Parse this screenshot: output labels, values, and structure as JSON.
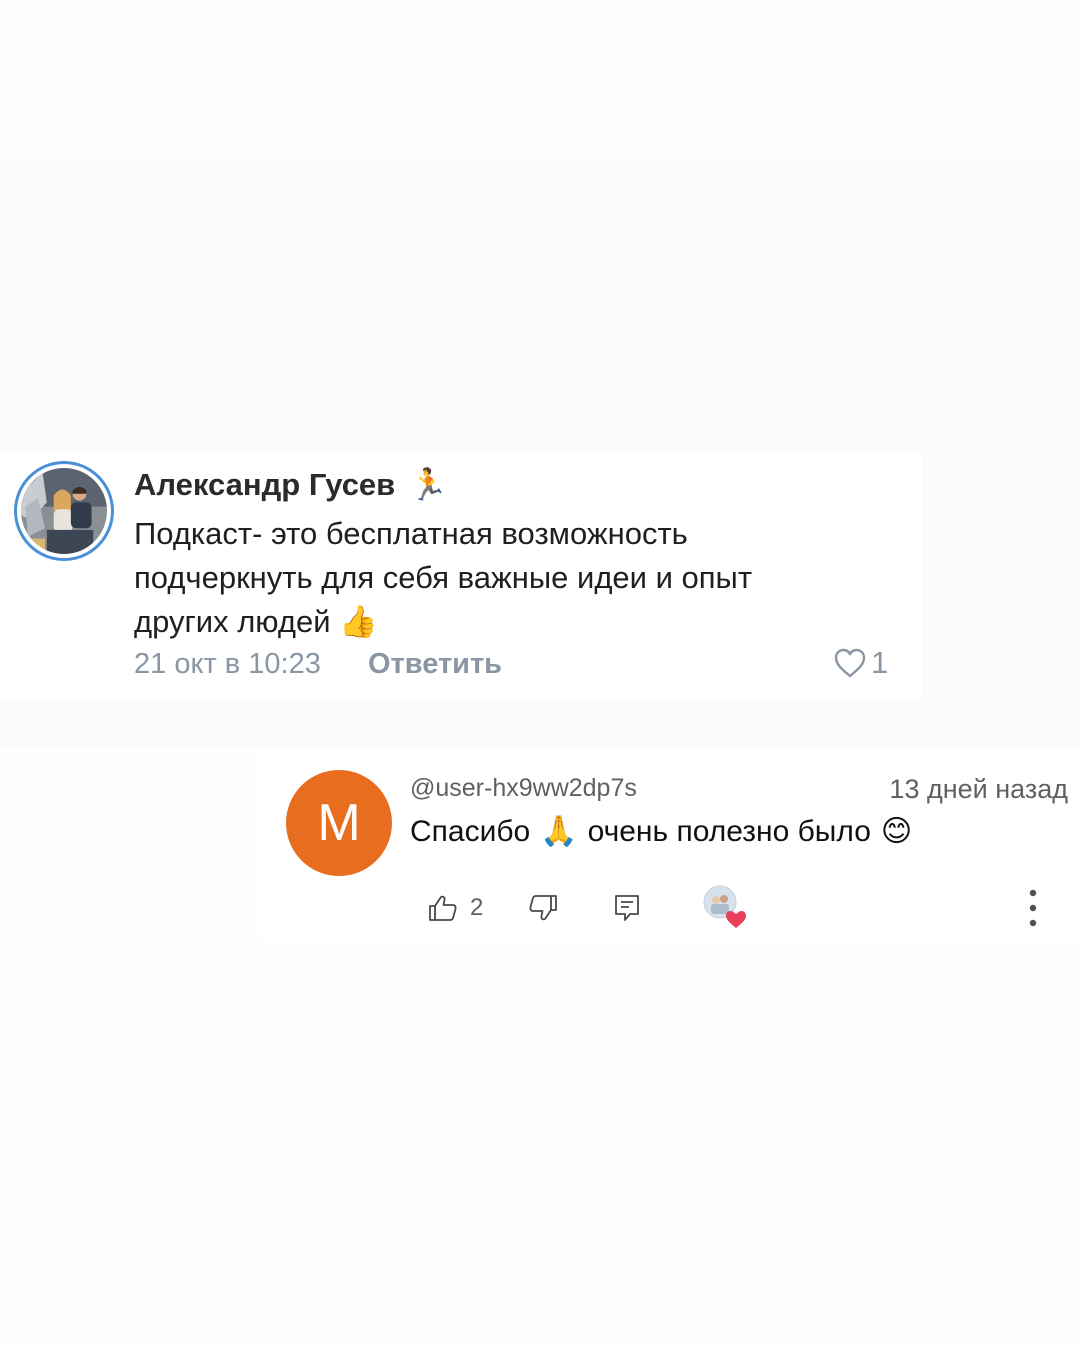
{
  "vk_comment": {
    "author": "Александр Гусев",
    "author_emoji": "🏃",
    "text_lines": [
      "Подкаст- это бесплатная возможность",
      "подчеркнуть для себя важные идеи и опыт",
      "других людей"
    ],
    "text_emoji": "👍",
    "date": "21 окт в 10:23",
    "reply_label": "Ответить",
    "like_count": "1"
  },
  "yt_comment": {
    "avatar_letter": "M",
    "avatar_color": "#e86d1f",
    "handle": "@user-hx9ww2dp7s",
    "time": "13 дней назад",
    "text_part1": "Спасибо",
    "text_emoji1": "🙏",
    "text_part2": "очень полезно было",
    "text_emoji2": "😊",
    "like_count": "2"
  },
  "icons": {
    "vk_like": "heart-outline-icon",
    "yt_like": "thumb-up-icon",
    "yt_dislike": "thumb-down-icon",
    "yt_replies": "comment-icon",
    "yt_creator_heart": "creator-heart-icon",
    "yt_more": "more-vertical-icon"
  }
}
